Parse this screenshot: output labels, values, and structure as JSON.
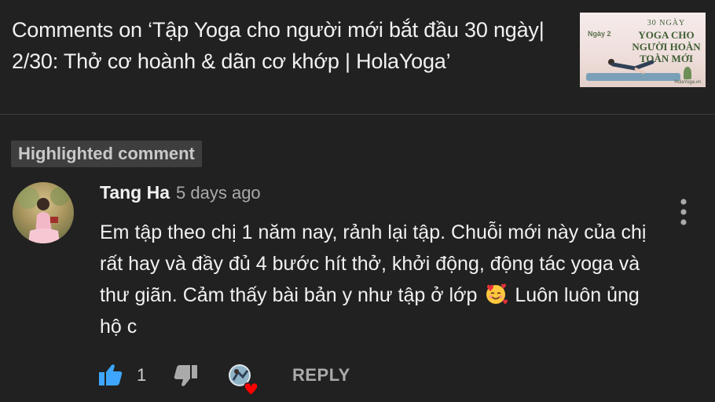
{
  "header": {
    "title": "Comments on ‘Tập Yoga cho người mới bắt đầu 30 ngày| 2/30: Thở cơ hoành & dãn cơ khớp | HolaYoga’",
    "thumbnail": {
      "day_label": "Ngày 2",
      "line1": "30 NGÀY",
      "line2": "YOGA CHO",
      "line3": "NGƯỜI HOÀN",
      "line4": "TOÀN MỚI",
      "brand": "HolaYoga.vn"
    }
  },
  "highlight": {
    "label": "Highlighted comment"
  },
  "comment": {
    "author": "Tang Ha",
    "timestamp": "5 days ago",
    "text_part1": "Em tập theo chị 1 năm nay, rảnh lại tập. Chuỗi mới này của chị rất hay và đầy đủ 4 bước hít thở, khởi động, động tác yoga và thư giãn. Cảm thấy bài bản y như tập ở lớp",
    "text_part2": "Luôn luôn ủng hộ c",
    "emoji": "smiling-face-with-hearts-icon"
  },
  "actions": {
    "like_count": "1",
    "reply_label": "REPLY"
  },
  "colors": {
    "background": "#212121",
    "like_active": "#3ea6ff",
    "heart": "#ff0000",
    "muted_text": "#aaaaaa"
  }
}
